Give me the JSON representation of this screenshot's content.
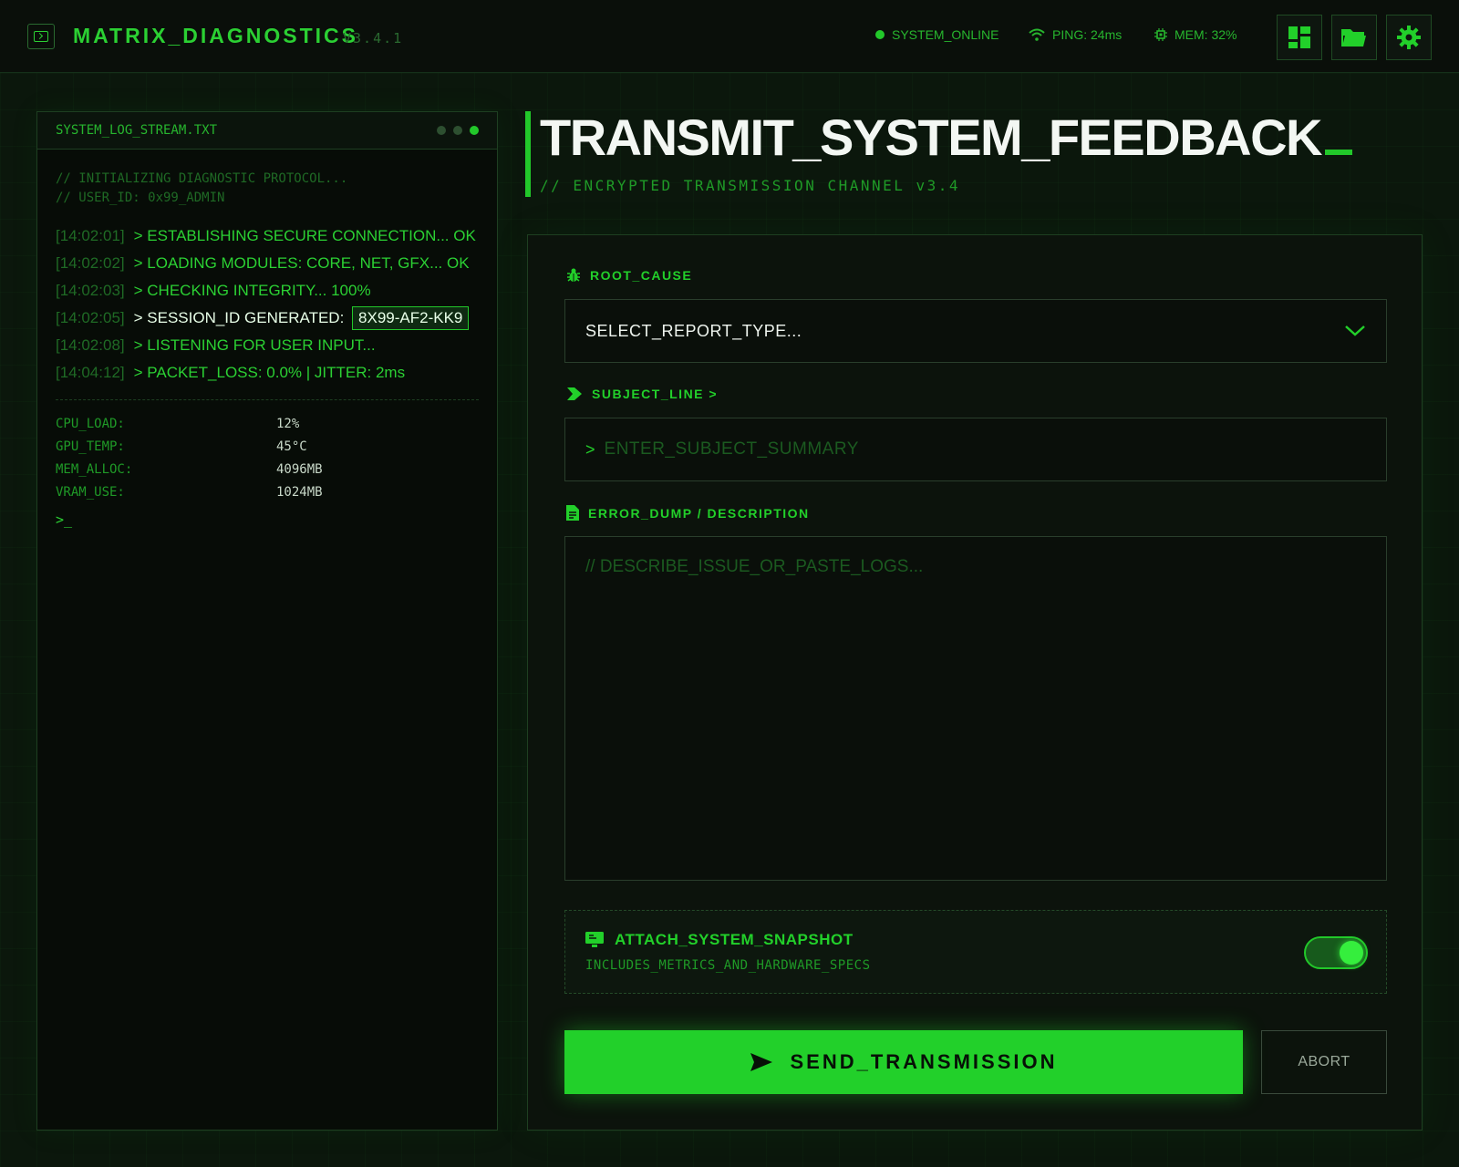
{
  "header": {
    "title": "MATRIX_DIAGNOSTICS",
    "version": "V3.4.1",
    "status_online": "SYSTEM_ONLINE",
    "ping": "PING: 24ms",
    "mem": "MEM: 32%",
    "icons": [
      "dashboard-icon",
      "folder-icon",
      "gear-icon"
    ]
  },
  "log": {
    "filename": "SYSTEM_LOG_STREAM.TXT",
    "comments": [
      "// INITIALIZING DIAGNOSTIC PROTOCOL...",
      "// USER_ID: 0x99_ADMIN"
    ],
    "lines": [
      {
        "ts": "[14:02:01]",
        "text": "> ESTABLISHING SECURE CONNECTION... OK"
      },
      {
        "ts": "[14:02:02]",
        "text": "> LOADING MODULES: CORE, NET, GFX... OK"
      },
      {
        "ts": "[14:02:03]",
        "text": "> CHECKING INTEGRITY... 100%"
      },
      {
        "ts": "[14:02:05]",
        "text": "> SESSION_ID GENERATED:",
        "badge": "8X99-AF2-KK9"
      },
      {
        "ts": "[14:02:08]",
        "text": "> LISTENING FOR USER INPUT..."
      },
      {
        "ts": "[14:04:12]",
        "text": "> PACKET_LOSS: 0.0% | JITTER: 2ms"
      }
    ],
    "stats": [
      {
        "key": "CPU_LOAD:",
        "value": "12%"
      },
      {
        "key": "GPU_TEMP:",
        "value": "45°C"
      },
      {
        "key": "MEM_ALLOC:",
        "value": "4096MB"
      },
      {
        "key": "VRAM_USE:",
        "value": "1024MB"
      }
    ],
    "prompt": ">_"
  },
  "main": {
    "title": "TRANSMIT_SYSTEM_FEEDBACK",
    "subtitle": "// ENCRYPTED TRANSMISSION CHANNEL v3.4"
  },
  "form": {
    "root_cause_label": "ROOT_CAUSE",
    "root_cause_value": "SELECT_REPORT_TYPE...",
    "subject_label": "SUBJECT_LINE >",
    "subject_caret": ">",
    "subject_placeholder": "ENTER_SUBJECT_SUMMARY",
    "description_label": "ERROR_DUMP / DESCRIPTION",
    "description_placeholder": "// DESCRIBE_ISSUE_OR_PASTE_LOGS...",
    "snapshot_title": "ATTACH_SYSTEM_SNAPSHOT",
    "snapshot_subtitle": "INCLUDES_METRICS_AND_HARDWARE_SPECS",
    "snapshot_enabled": true,
    "send_label": "SEND_TRANSMISSION",
    "abort_label": "ABORT"
  },
  "colors": {
    "accent": "#22d02a",
    "background": "#0b170c",
    "text_light": "#eef4ee"
  }
}
